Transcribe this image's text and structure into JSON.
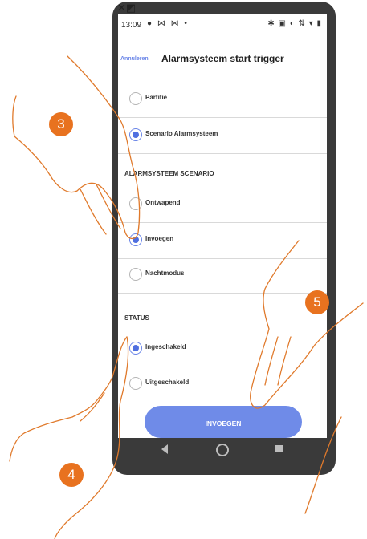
{
  "status_bar": {
    "time": "13:09",
    "left_icons": "● ⋈ ⋈ •",
    "right_icons": "✱ ▣ ◐ ⇅ ▾ ▮"
  },
  "header": {
    "cancel_label": "Annuleren",
    "title": "Alarmsysteem start trigger"
  },
  "trigger_options": [
    {
      "label": "Partitie",
      "selected": false
    },
    {
      "label": "Scenario Alarmsysteem",
      "selected": true
    }
  ],
  "scenario_section": {
    "heading": "ALARMSYSTEEM SCENARIO",
    "options": [
      {
        "label": "Ontwapend",
        "selected": false
      },
      {
        "label": "Invoegen",
        "selected": true
      },
      {
        "label": "Nachtmodus",
        "selected": false
      }
    ]
  },
  "status_section": {
    "heading": "STATUS",
    "options": [
      {
        "label": "Ingeschakeld",
        "selected": true
      },
      {
        "label": "Uitgeschakeld",
        "selected": false
      }
    ]
  },
  "primary_button": "INVOEGEN",
  "step_badges": [
    "3",
    "4",
    "5"
  ],
  "colors": {
    "accent": "#4f6fe0",
    "button": "#6f8be8",
    "badge": "#e8721f",
    "hand_outline": "#e07a2c"
  }
}
